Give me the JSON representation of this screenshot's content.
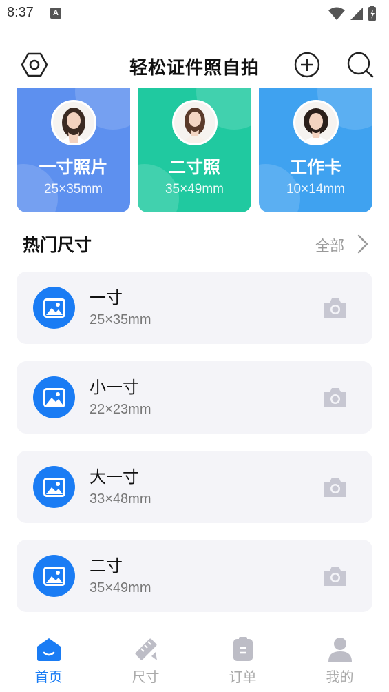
{
  "status_bar": {
    "time": "8:37",
    "notification_letter": "A"
  },
  "header": {
    "title": "轻松证件照自拍"
  },
  "cards": [
    {
      "title": "一寸照片",
      "size": "25×35mm"
    },
    {
      "title": "二寸照",
      "size": "35×49mm"
    },
    {
      "title": "工作卡",
      "size": "10×14mm"
    }
  ],
  "section": {
    "title": "热门尺寸",
    "see_all": "全部"
  },
  "list": [
    {
      "name": "一寸",
      "size": "25×35mm"
    },
    {
      "name": "小一寸",
      "size": "22×23mm"
    },
    {
      "name": "大一寸",
      "size": "33×48mm"
    },
    {
      "name": "二寸",
      "size": "35×49mm"
    }
  ],
  "nav": [
    {
      "label": "首页",
      "icon": "home-icon",
      "active": true
    },
    {
      "label": "尺寸",
      "icon": "ruler-icon",
      "active": false
    },
    {
      "label": "订单",
      "icon": "order-clipboard-icon",
      "active": false
    },
    {
      "label": "我的",
      "icon": "user-icon",
      "active": false
    }
  ],
  "colors": {
    "accent": "#1a7cf4",
    "card1": "#5d90ef",
    "card2": "#20c9a0",
    "card3": "#3fa2f0",
    "list_bg": "#f4f4f8"
  }
}
